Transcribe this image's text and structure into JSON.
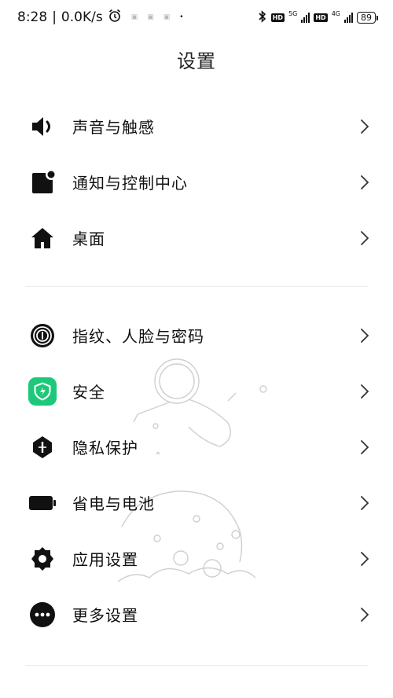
{
  "status_bar": {
    "time": "8:28",
    "speed": "0.0K/s",
    "sim1_network": "5G",
    "sim2_network": "4G",
    "hd_label": "HD",
    "battery": "89"
  },
  "page": {
    "title": "设置"
  },
  "groups": [
    {
      "items": [
        {
          "label": "声音与触感",
          "icon": "speaker-icon"
        },
        {
          "label": "通知与控制中心",
          "icon": "notification-icon"
        },
        {
          "label": "桌面",
          "icon": "home-icon"
        }
      ]
    },
    {
      "items": [
        {
          "label": "指纹、人脸与密码",
          "icon": "fingerprint-icon"
        },
        {
          "label": "安全",
          "icon": "security-shield-icon",
          "accent": "#1ec87a"
        },
        {
          "label": "隐私保护",
          "icon": "privacy-icon"
        },
        {
          "label": "省电与电池",
          "icon": "battery-icon"
        },
        {
          "label": "应用设置",
          "icon": "gear-icon"
        },
        {
          "label": "更多设置",
          "icon": "more-icon"
        }
      ]
    }
  ]
}
